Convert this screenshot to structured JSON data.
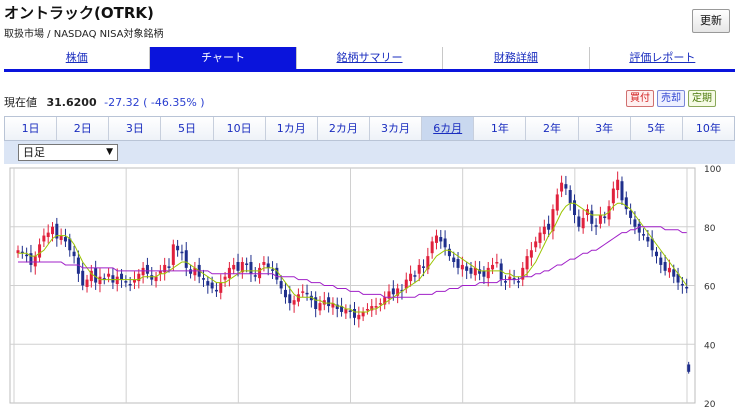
{
  "header": {
    "title": "オントラック(OTRK)",
    "subtitle": "取扱市場 / NASDAQ NISA対象銘柄",
    "refresh_label": "更新"
  },
  "nav": {
    "tabs": [
      "株価",
      "チャート",
      "銘柄サマリー",
      "財務詳細",
      "評価レポート"
    ],
    "active": "チャート"
  },
  "quote": {
    "label": "現在値",
    "price": "31.6200",
    "change": "-27.32 ( -46.35% )"
  },
  "order_buttons": {
    "buy": "買付",
    "sell": "売却",
    "fixed": "定期"
  },
  "periods": {
    "tabs": [
      "1日",
      "2日",
      "3日",
      "5日",
      "10日",
      "1カ月",
      "2カ月",
      "3カ月",
      "6カ月",
      "1年",
      "2年",
      "3年",
      "5年",
      "10年"
    ],
    "active": "6カ月"
  },
  "interval_select": {
    "value": "日足"
  },
  "colors": {
    "accent": "#0a14dc",
    "candle_up": "#e0213c",
    "candle_down": "#1f2f8c",
    "ma_short": "#9bc400",
    "ma_long": "#a020c8"
  },
  "chart_data": {
    "type": "candlestick",
    "ylim": [
      20,
      100
    ],
    "yticks": [
      20,
      40,
      60,
      80,
      100
    ],
    "grid": true,
    "series": [
      {
        "kind": "candle",
        "close": [
          72,
          71,
          70,
          67,
          70,
          74,
          77,
          78,
          80,
          76,
          77,
          75,
          72,
          70,
          64,
          60,
          62,
          65,
          61,
          63,
          62,
          64,
          61,
          63,
          62,
          61,
          60,
          62,
          64,
          66,
          64,
          62,
          63,
          65,
          67,
          66,
          74,
          72,
          71,
          66,
          64,
          66,
          63,
          62,
          60,
          59,
          58,
          61,
          63,
          66,
          67,
          65,
          68,
          67,
          64,
          63,
          66,
          68,
          66,
          65,
          62,
          59,
          56,
          54,
          55,
          57,
          58,
          57,
          55,
          52,
          54,
          55,
          53,
          54,
          52,
          51,
          52,
          51,
          49,
          50,
          51,
          52,
          53,
          53,
          54,
          56,
          58,
          57,
          59,
          58,
          62,
          64,
          63,
          67,
          66,
          70,
          75,
          77,
          75,
          73,
          70,
          68,
          66,
          67,
          65,
          64,
          66,
          64,
          63,
          66,
          67,
          68,
          62,
          61,
          63,
          62,
          61,
          66,
          70,
          72,
          75,
          78,
          80,
          79,
          86,
          91,
          95,
          93,
          88,
          84,
          80,
          83,
          86,
          81,
          80,
          84,
          83,
          87,
          93,
          96,
          89,
          86,
          83,
          80,
          78,
          77,
          75,
          72,
          70,
          67,
          65,
          66,
          63,
          61,
          60,
          59
        ]
      }
    ],
    "ma": [
      {
        "name": "short",
        "values": [
          71,
          71,
          71,
          70,
          70,
          71,
          72,
          74,
          76,
          77,
          77,
          77,
          76,
          74,
          71,
          68,
          66,
          64,
          63,
          62,
          62,
          62,
          62,
          62,
          62,
          62,
          62,
          62,
          62,
          63,
          63,
          63,
          63,
          64,
          64,
          65,
          66,
          67,
          68,
          68,
          67,
          66,
          65,
          64,
          63,
          62,
          61,
          61,
          61,
          62,
          63,
          64,
          65,
          65,
          65,
          65,
          65,
          66,
          66,
          66,
          65,
          63,
          61,
          59,
          57,
          56,
          56,
          56,
          56,
          55,
          55,
          54,
          54,
          54,
          53,
          53,
          52,
          52,
          51,
          51,
          51,
          51,
          52,
          52,
          53,
          54,
          55,
          56,
          57,
          58,
          59,
          60,
          61,
          62,
          64,
          66,
          68,
          70,
          71,
          72,
          72,
          71,
          70,
          69,
          68,
          67,
          66,
          65,
          65,
          65,
          65,
          65,
          65,
          64,
          64,
          63,
          63,
          63,
          64,
          66,
          68,
          71,
          74,
          77,
          79,
          82,
          85,
          87,
          88,
          88,
          87,
          86,
          85,
          84,
          84,
          84,
          84,
          85,
          87,
          88,
          88,
          87,
          86,
          84,
          82,
          80,
          78,
          76,
          74,
          72,
          70,
          68,
          66,
          64,
          62,
          60
        ]
      },
      {
        "name": "long",
        "values": [
          68,
          68,
          68,
          68,
          68,
          68,
          68,
          68,
          68,
          68,
          68,
          67,
          67,
          67,
          67,
          66,
          66,
          66,
          66,
          66,
          66,
          66,
          66,
          65,
          65,
          65,
          65,
          65,
          65,
          65,
          65,
          65,
          65,
          65,
          65,
          65,
          65,
          65,
          65,
          65,
          65,
          65,
          65,
          65,
          65,
          64,
          64,
          64,
          64,
          64,
          64,
          64,
          64,
          64,
          64,
          64,
          64,
          64,
          64,
          64,
          63,
          63,
          63,
          63,
          63,
          62,
          62,
          62,
          61,
          61,
          61,
          60,
          60,
          60,
          59,
          59,
          59,
          58,
          58,
          58,
          57,
          57,
          57,
          57,
          57,
          56,
          56,
          56,
          56,
          56,
          56,
          56,
          56,
          57,
          57,
          57,
          57,
          58,
          58,
          58,
          59,
          59,
          59,
          60,
          60,
          60,
          60,
          61,
          61,
          61,
          61,
          61,
          62,
          62,
          62,
          62,
          62,
          63,
          63,
          63,
          64,
          64,
          65,
          65,
          66,
          67,
          67,
          68,
          69,
          69,
          70,
          71,
          71,
          72,
          72,
          73,
          74,
          75,
          76,
          77,
          78,
          78,
          79,
          79,
          80,
          80,
          80,
          80,
          80,
          80,
          79,
          79,
          79,
          79,
          78,
          78
        ]
      }
    ],
    "last_gap_close": 31.62
  }
}
